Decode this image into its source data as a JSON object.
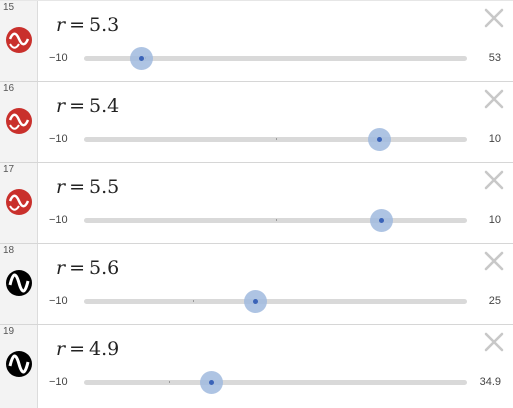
{
  "colors": {
    "red_icon": "#c9302c",
    "black_icon": "#000000",
    "slider_thumb": "#a0badE",
    "slider_dot": "#3a63b8",
    "close_x": "#c8c8c8"
  },
  "rows": [
    {
      "number": "15",
      "variable": "r",
      "equals": "=",
      "value": "5.3",
      "min": "−10",
      "max": "53",
      "slider_fraction": 0.149,
      "icon": "sine-wave-icon-red",
      "icon_color": "red"
    },
    {
      "number": "16",
      "variable": "r",
      "equals": "=",
      "value": "5.4",
      "min": "−10",
      "max": "10",
      "slider_fraction": 0.77,
      "icon": "sine-wave-icon-red",
      "icon_color": "red"
    },
    {
      "number": "17",
      "variable": "r",
      "equals": "=",
      "value": "5.5",
      "min": "−10",
      "max": "10",
      "slider_fraction": 0.775,
      "icon": "sine-wave-icon-red",
      "icon_color": "red"
    },
    {
      "number": "18",
      "variable": "r",
      "equals": "=",
      "value": "5.6",
      "min": "−10",
      "max": "25",
      "slider_fraction": 0.446,
      "icon": "sine-wave-icon-black",
      "icon_color": "black"
    },
    {
      "number": "19",
      "variable": "r",
      "equals": "=",
      "value": "4.9",
      "min": "−10",
      "max": "34.9",
      "slider_fraction": 0.332,
      "icon": "sine-wave-icon-black",
      "icon_color": "black"
    }
  ]
}
